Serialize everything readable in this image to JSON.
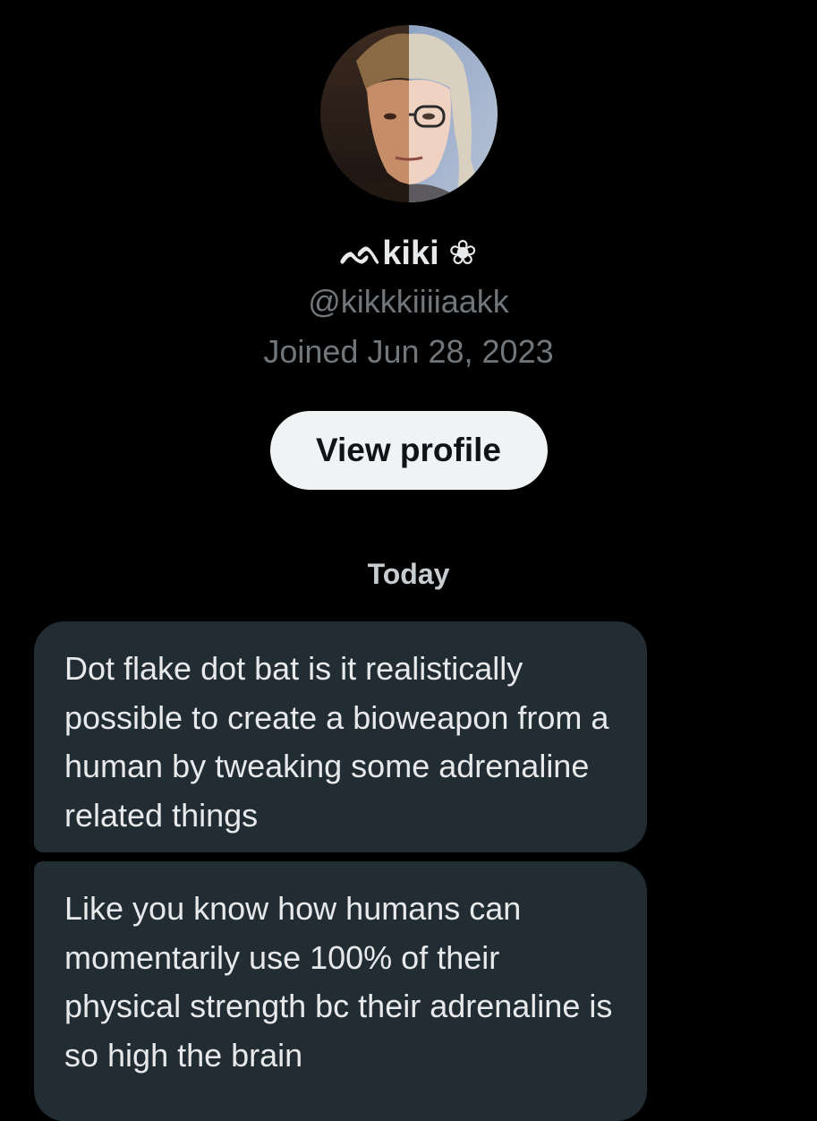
{
  "profile": {
    "display_name": "ᨒkiki ❀",
    "handle": "@kikkkiiiiaakk",
    "joined": "Joined Jun 28, 2023",
    "view_profile_label": "View profile"
  },
  "conversation": {
    "date_label": "Today",
    "messages": [
      {
        "text": "Dot flake dot bat is it realistically possible to create a bioweapon from a human by tweaking some adrenaline related things"
      },
      {
        "text": "Like you know how humans can momentarily use 100% of their physical strength bc their adrenaline is so high the brain"
      }
    ]
  },
  "colors": {
    "background": "#000000",
    "bubble": "#222c33",
    "secondary_text": "#71767b",
    "button_bg": "#eff3f4"
  }
}
